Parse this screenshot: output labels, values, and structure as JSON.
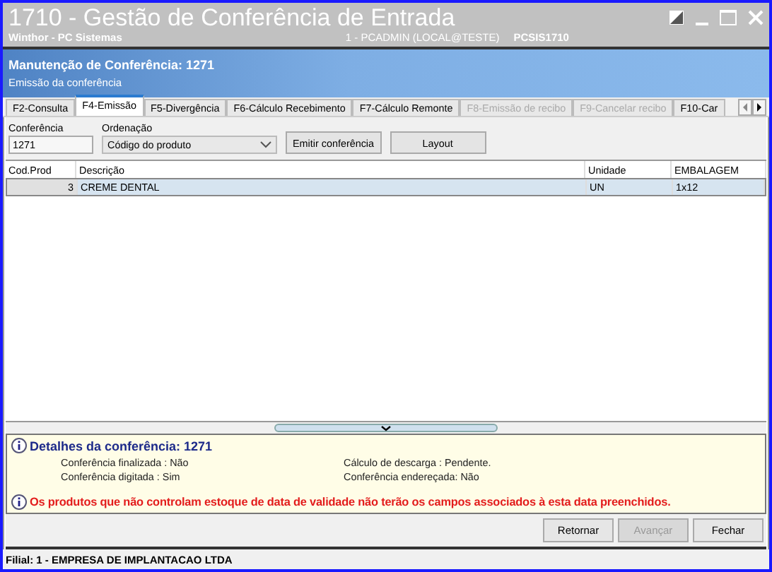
{
  "window": {
    "title": "1710 - Gestão de Conferência de Entrada",
    "subtitle": "Winthor - PC Sistemas",
    "session": "1 - PCADMIN (LOCAL@TESTE)",
    "program": "PCSIS1710"
  },
  "header": {
    "title": "Manutenção de Conferência: 1271",
    "subtitle": "Emissão da conferência"
  },
  "tabs": [
    {
      "label": "F2-Consulta",
      "selected": false,
      "disabled": false
    },
    {
      "label": "F4-Emissão",
      "selected": true,
      "disabled": false
    },
    {
      "label": "F5-Divergência",
      "selected": false,
      "disabled": false
    },
    {
      "label": "F6-Cálculo Recebimento",
      "selected": false,
      "disabled": false
    },
    {
      "label": "F7-Cálculo Remonte",
      "selected": false,
      "disabled": false
    },
    {
      "label": "F8-Emissão de recibo",
      "selected": false,
      "disabled": true
    },
    {
      "label": "F9-Cancelar recibo",
      "selected": false,
      "disabled": true
    },
    {
      "label": "F10-Car",
      "selected": false,
      "disabled": false
    }
  ],
  "form": {
    "conferencia": {
      "label": "Conferência",
      "value": "1271"
    },
    "ordenacao": {
      "label": "Ordenação",
      "value": "Código do produto"
    },
    "buttons": [
      "Emitir conferência",
      "Layout"
    ]
  },
  "table": {
    "columns": [
      "Cod.Prod",
      "Descrição",
      "Unidade",
      "EMBALAGEM"
    ],
    "rows": [
      {
        "cells": [
          "3",
          "CREME DENTAL",
          "UN",
          "1x12"
        ],
        "selected": true
      }
    ]
  },
  "details": {
    "title": "Detalhes da conferência: 1271",
    "items": [
      "Conferência finalizada : Não",
      "Cálculo de descarga : Pendente.",
      "Conferência digitada : Sim",
      "Conferência endereçada: Não"
    ],
    "warning": "Os produtos que não controlam estoque de data de validade não terão os campos associados à esta data preenchidos."
  },
  "buttons": [
    {
      "label": "Retornar",
      "disabled": false
    },
    {
      "label": "Avançar",
      "disabled": true
    },
    {
      "label": "Fechar",
      "disabled": false
    }
  ],
  "status_bar": "Filial: 1 - EMPRESA DE IMPLANTACAO LTDA"
}
